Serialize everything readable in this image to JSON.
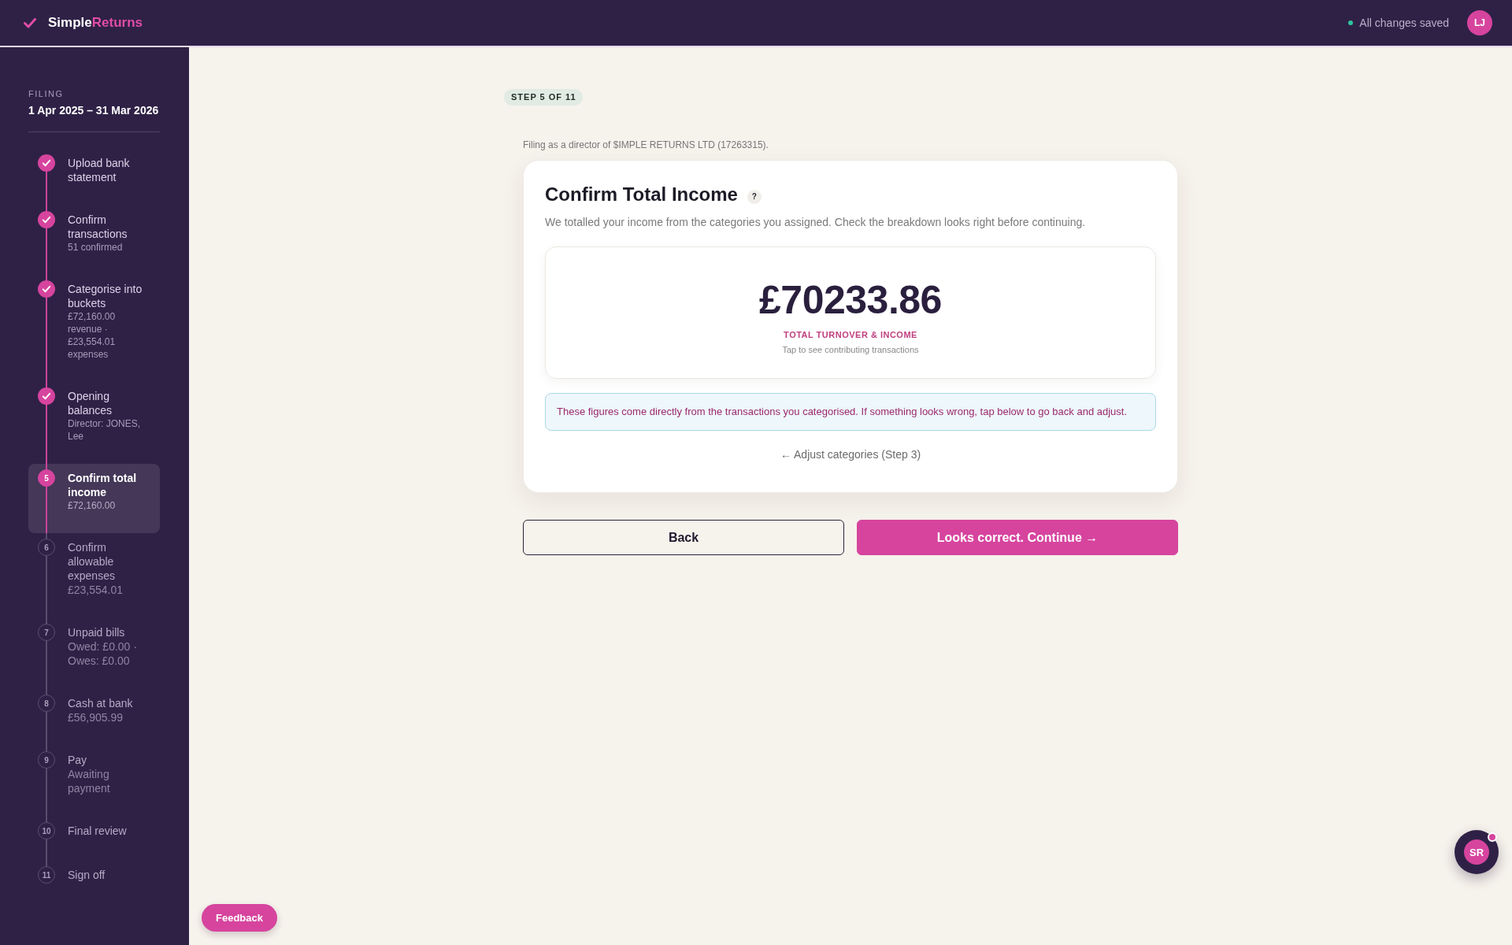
{
  "header": {
    "brand": {
      "first": "Simple",
      "accent": "Returns"
    },
    "save_status": "All changes saved",
    "avatar_initials": "LJ"
  },
  "sidebar": {
    "section_label": "FILING",
    "period": "1 Apr 2025 – 31 Mar 2026",
    "steps": [
      {
        "done": true,
        "selected": false,
        "title": "Upload bank statement"
      },
      {
        "done": true,
        "selected": false,
        "title": "Confirm transactions",
        "detail": "51 confirmed"
      },
      {
        "done": true,
        "selected": false,
        "title": "Categorise into buckets",
        "detail": "£72,160.00 revenue · £23,554.01 expenses"
      },
      {
        "done": true,
        "selected": false,
        "title": "Opening balances",
        "detail": "Director: JONES, Lee"
      },
      {
        "done": false,
        "selected": true,
        "number": "5",
        "title": "Confirm total income",
        "detail": "£72,160.00"
      },
      {
        "done": false,
        "selected": false,
        "number": "6",
        "title": "Confirm allowable expenses",
        "detail": "£23,554.01"
      },
      {
        "done": false,
        "selected": false,
        "number": "7",
        "title": "Unpaid bills",
        "detail": "Owed: £0.00 · Owes: £0.00"
      },
      {
        "done": false,
        "selected": false,
        "number": "8",
        "title": "Cash at bank",
        "detail": "£56,905.99"
      },
      {
        "done": false,
        "selected": false,
        "number": "9",
        "title": "Pay",
        "detail": "Awaiting payment"
      },
      {
        "done": false,
        "selected": false,
        "number": "10",
        "title": "Final review"
      },
      {
        "done": false,
        "selected": false,
        "number": "11",
        "title": "Sign off"
      }
    ]
  },
  "main": {
    "step_counter": "STEP 5 OF 11",
    "filing_note": "Filing as a director of $IMPLE RETURNS LTD (17263315).",
    "card": {
      "title": "Confirm Total Income",
      "help": "?",
      "description": "We totalled your income from the categories you assigned. Check the breakdown looks right before continuing.",
      "total": {
        "amount": "£70233.86",
        "label": "TOTAL TURNOVER & INCOME",
        "hint": "Tap to see contributing transactions"
      },
      "note": "These figures come directly from the transactions you categorised. If something looks wrong, tap below to go back and adjust.",
      "adjust_link": "← Adjust categories (Step 3)"
    },
    "buttons": [
      {
        "kind": "secondary",
        "label": "Back"
      },
      {
        "kind": "primary",
        "label": "Looks correct. Continue →"
      }
    ]
  },
  "feedback_button": "Feedback",
  "chat": {
    "initials": "SR",
    "unread": true
  }
}
